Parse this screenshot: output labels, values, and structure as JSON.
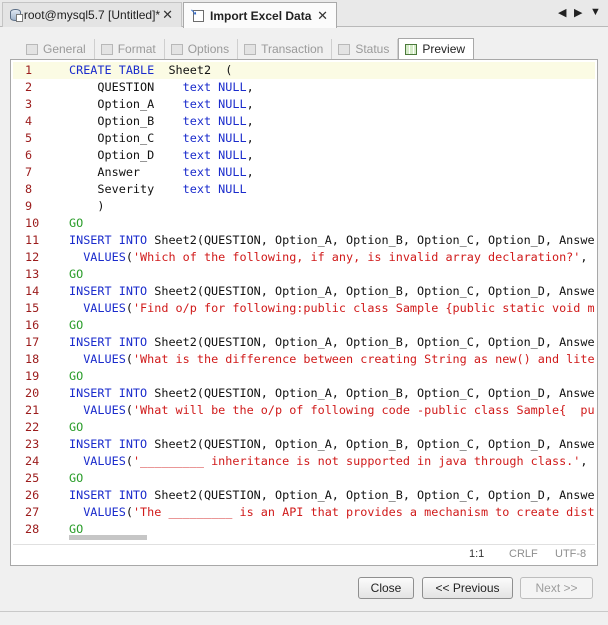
{
  "editor_tabs": [
    {
      "label": "root@mysql5.7 [Untitled]*",
      "close": "✕"
    },
    {
      "label": "Import Excel Data",
      "close": "✕"
    }
  ],
  "nav": {
    "prev": "◀",
    "next": "▶",
    "menu": "▼"
  },
  "steps": [
    {
      "label": "General"
    },
    {
      "label": "Format"
    },
    {
      "label": "Options"
    },
    {
      "label": "Transaction"
    },
    {
      "label": "Status"
    },
    {
      "label": "Preview"
    }
  ],
  "code_lines": [
    {
      "n": "1",
      "segs": [
        [
          "kw",
          "CREATE TABLE"
        ],
        [
          "",
          "  Sheet2  ("
        ]
      ]
    },
    {
      "n": "2",
      "segs": [
        [
          "",
          "    QUESTION    "
        ],
        [
          "kw",
          "text NULL"
        ],
        [
          "",
          ","
        ]
      ]
    },
    {
      "n": "3",
      "segs": [
        [
          "",
          "    Option_A    "
        ],
        [
          "kw",
          "text NULL"
        ],
        [
          "",
          ","
        ]
      ]
    },
    {
      "n": "4",
      "segs": [
        [
          "",
          "    Option_B    "
        ],
        [
          "kw",
          "text NULL"
        ],
        [
          "",
          ","
        ]
      ]
    },
    {
      "n": "5",
      "segs": [
        [
          "",
          "    Option_C    "
        ],
        [
          "kw",
          "text NULL"
        ],
        [
          "",
          ","
        ]
      ]
    },
    {
      "n": "6",
      "segs": [
        [
          "",
          "    Option_D    "
        ],
        [
          "kw",
          "text NULL"
        ],
        [
          "",
          ","
        ]
      ]
    },
    {
      "n": "7",
      "segs": [
        [
          "",
          "    Answer      "
        ],
        [
          "kw",
          "text NULL"
        ],
        [
          "",
          ","
        ]
      ]
    },
    {
      "n": "8",
      "segs": [
        [
          "",
          "    Severity    "
        ],
        [
          "kw",
          "text NULL"
        ]
      ]
    },
    {
      "n": "9",
      "segs": [
        [
          "",
          "    )"
        ]
      ]
    },
    {
      "n": "10",
      "segs": [
        [
          "go",
          "GO"
        ]
      ]
    },
    {
      "n": "11",
      "segs": [
        [
          "kw",
          "INSERT INTO"
        ],
        [
          "",
          " Sheet2(QUESTION, Option_A, Option_B, Option_C, Option_D, Answer"
        ]
      ]
    },
    {
      "n": "12",
      "segs": [
        [
          "kw",
          "  VALUES"
        ],
        [
          "",
          "("
        ],
        [
          "str",
          "'Which of the following, if any, is invalid array declaration?'"
        ],
        [
          "",
          ", '"
        ]
      ]
    },
    {
      "n": "13",
      "segs": [
        [
          "go",
          "GO"
        ]
      ]
    },
    {
      "n": "14",
      "segs": [
        [
          "kw",
          "INSERT INTO"
        ],
        [
          "",
          " Sheet2(QUESTION, Option_A, Option_B, Option_C, Option_D, Answer"
        ]
      ]
    },
    {
      "n": "15",
      "segs": [
        [
          "kw",
          "  VALUES"
        ],
        [
          "",
          "("
        ],
        [
          "str",
          "'Find o/p for following:public class Sample {public static void ma"
        ]
      ]
    },
    {
      "n": "16",
      "segs": [
        [
          "go",
          "GO"
        ]
      ]
    },
    {
      "n": "17",
      "segs": [
        [
          "kw",
          "INSERT INTO"
        ],
        [
          "",
          " Sheet2(QUESTION, Option_A, Option_B, Option_C, Option_D, Answer"
        ]
      ]
    },
    {
      "n": "18",
      "segs": [
        [
          "kw",
          "  VALUES"
        ],
        [
          "",
          "("
        ],
        [
          "str",
          "'What is the difference between creating String as new() and liter"
        ]
      ]
    },
    {
      "n": "19",
      "segs": [
        [
          "go",
          "GO"
        ]
      ]
    },
    {
      "n": "20",
      "segs": [
        [
          "kw",
          "INSERT INTO"
        ],
        [
          "",
          " Sheet2(QUESTION, Option_A, Option_B, Option_C, Option_D, Answer"
        ]
      ]
    },
    {
      "n": "21",
      "segs": [
        [
          "kw",
          "  VALUES"
        ],
        [
          "",
          "("
        ],
        [
          "str",
          "'What will be the o/p of following code -public class Sample{  pub"
        ]
      ]
    },
    {
      "n": "22",
      "segs": [
        [
          "go",
          "GO"
        ]
      ]
    },
    {
      "n": "23",
      "segs": [
        [
          "kw",
          "INSERT INTO"
        ],
        [
          "",
          " Sheet2(QUESTION, Option_A, Option_B, Option_C, Option_D, Answer"
        ]
      ]
    },
    {
      "n": "24",
      "segs": [
        [
          "kw",
          "  VALUES"
        ],
        [
          "",
          "("
        ],
        [
          "str",
          "'_________ inheritance is not supported in java through class.'"
        ],
        [
          "",
          ", '"
        ]
      ]
    },
    {
      "n": "25",
      "segs": [
        [
          "go",
          "GO"
        ]
      ]
    },
    {
      "n": "26",
      "segs": [
        [
          "kw",
          "INSERT INTO"
        ],
        [
          "",
          " Sheet2(QUESTION, Option_A, Option_B, Option_C, Option_D, Answer"
        ]
      ]
    },
    {
      "n": "27",
      "segs": [
        [
          "kw",
          "  VALUES"
        ],
        [
          "",
          "("
        ],
        [
          "str",
          "'The _________ is an API that provides a mechanism to create distr"
        ]
      ]
    },
    {
      "n": "28",
      "segs": [
        [
          "go",
          "GO"
        ]
      ]
    }
  ],
  "statusbar": {
    "position": "1:1",
    "eol": "CRLF",
    "encoding": "UTF-8"
  },
  "buttons": {
    "close": "Close",
    "previous": "<< Previous",
    "next": "Next >>"
  }
}
